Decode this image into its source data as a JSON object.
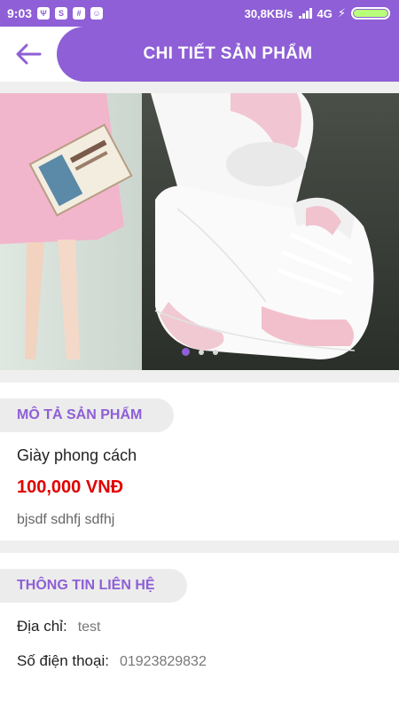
{
  "status_bar": {
    "time": "9:03",
    "speed": "30,8KB/s",
    "network": "4G"
  },
  "header": {
    "title": "CHI TIẾT SẢN PHẨM",
    "back_icon": "arrow-left-icon"
  },
  "carousel": {
    "active_index": 0,
    "dot_count": 3
  },
  "description_section": {
    "title": "MÔ TẢ SẢN PHẨM",
    "product_name": "Giày phong cách",
    "price": "100,000 VNĐ",
    "details": "bjsdf sdhfj sdfhj"
  },
  "contact_section": {
    "title": "THÔNG TIN LIÊN HỆ",
    "address_label": "Địa chỉ:",
    "address_value": "test",
    "phone_label": "Số điện thoại:",
    "phone_value": "01923829832"
  },
  "colors": {
    "accent": "#8e5fd6",
    "price": "#e00000"
  }
}
